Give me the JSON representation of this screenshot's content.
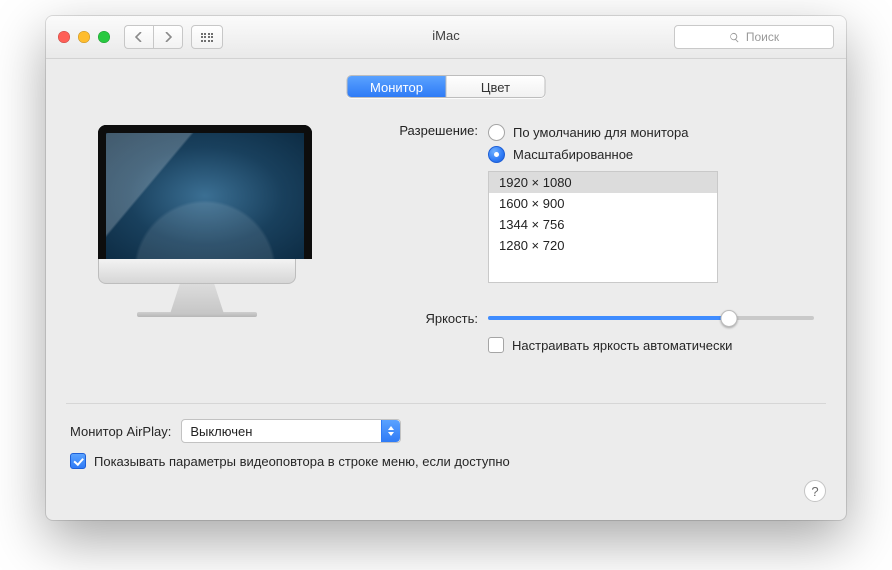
{
  "window": {
    "title": "iMac"
  },
  "toolbar": {
    "search_placeholder": "Поиск"
  },
  "tabs": {
    "monitor": "Монитор",
    "color": "Цвет",
    "active": "monitor"
  },
  "resolution": {
    "label": "Разрешение:",
    "option_default": "По умолчанию для монитора",
    "option_scaled": "Масштабированное",
    "selected": "scaled",
    "list": [
      "1920 × 1080",
      "1600 × 900",
      "1344 × 756",
      "1280 × 720"
    ],
    "list_selected_index": 0
  },
  "brightness": {
    "label": "Яркость:",
    "value_percent": 74,
    "auto_label": "Настраивать яркость автоматически",
    "auto_checked": false
  },
  "airplay": {
    "label": "Монитор AirPlay:",
    "value": "Выключен"
  },
  "mirroring": {
    "label": "Показывать параметры видеоповтора в строке меню, если доступно",
    "checked": true
  },
  "help": {
    "label": "?"
  },
  "icons": {
    "apple_glyph": ""
  }
}
